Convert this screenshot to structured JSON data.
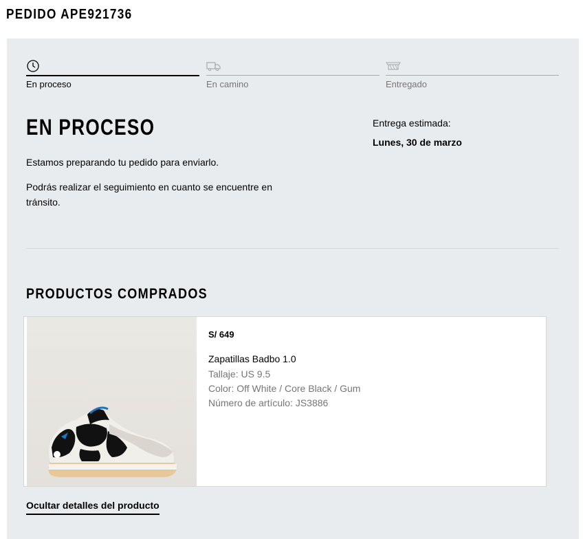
{
  "order": {
    "title": "PEDIDO APE921736"
  },
  "steps": [
    {
      "label": "En proceso",
      "icon": "clock-icon",
      "active": true
    },
    {
      "label": "En camino",
      "icon": "truck-icon",
      "active": false
    },
    {
      "label": "Entregado",
      "icon": "package-delivered-icon",
      "active": false
    }
  ],
  "status": {
    "title": "EN PROCESO",
    "text1": "Estamos preparando tu pedido para enviarlo.",
    "text2": "Podrás realizar el seguimiento en cuanto se encuentre en tránsito."
  },
  "delivery": {
    "label": "Entrega estimada:",
    "date": "Lunes, 30 de marzo"
  },
  "products": {
    "title": "PRODUCTOS COMPRADOS",
    "items": [
      {
        "price": "S/ 649",
        "name": "Zapatillas Badbo 1.0",
        "size": "Tallaje: US 9.5",
        "color": "Color: Off White / Core Black / Gum",
        "article": "Número de artículo: JS3886",
        "image": "sneaker-image"
      }
    ]
  },
  "toggle_details_label": "Ocultar detalles del producto",
  "colors": {
    "panel_bg": "#e9ecef",
    "text": "#000000",
    "muted": "#767677",
    "accent_blue": "#1e73be"
  }
}
